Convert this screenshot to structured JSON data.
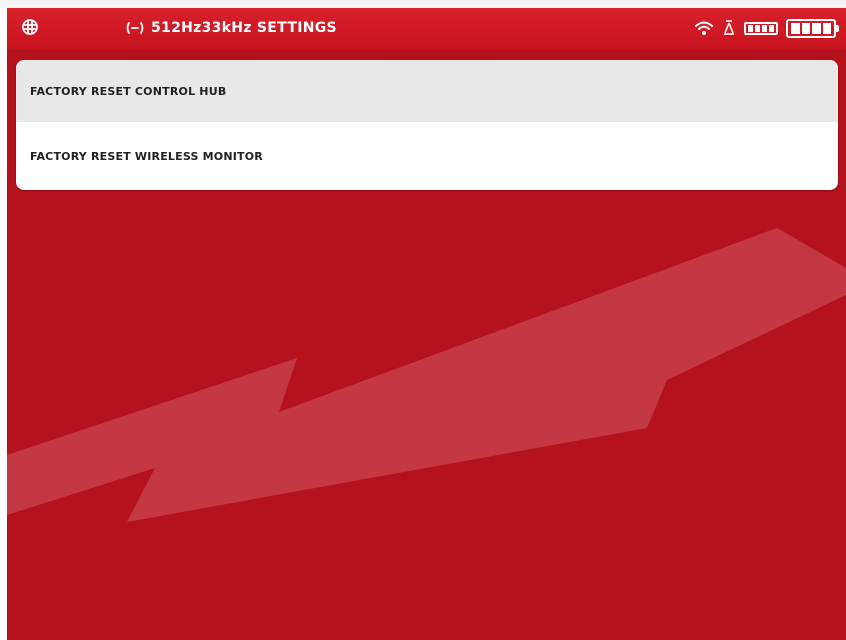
{
  "header": {
    "title": "512Hz33kHz SETTINGS",
    "icons": {
      "left": "grid-icon",
      "title_prefix": "signal-icon",
      "wifi": "wifi-icon",
      "monitor": "monitor-icon",
      "small_battery": "battery-small-icon",
      "main_battery": "battery-full-icon"
    }
  },
  "settings": {
    "items": [
      {
        "label": "FACTORY RESET CONTROL HUB",
        "selected": true
      },
      {
        "label": "FACTORY RESET WIRELESS MONITOR",
        "selected": false
      }
    ]
  },
  "colors": {
    "brand_red": "#c8141f",
    "background_red": "#b5121e",
    "bolt": "#c73f4a",
    "selected_row": "#e8e8e8"
  }
}
